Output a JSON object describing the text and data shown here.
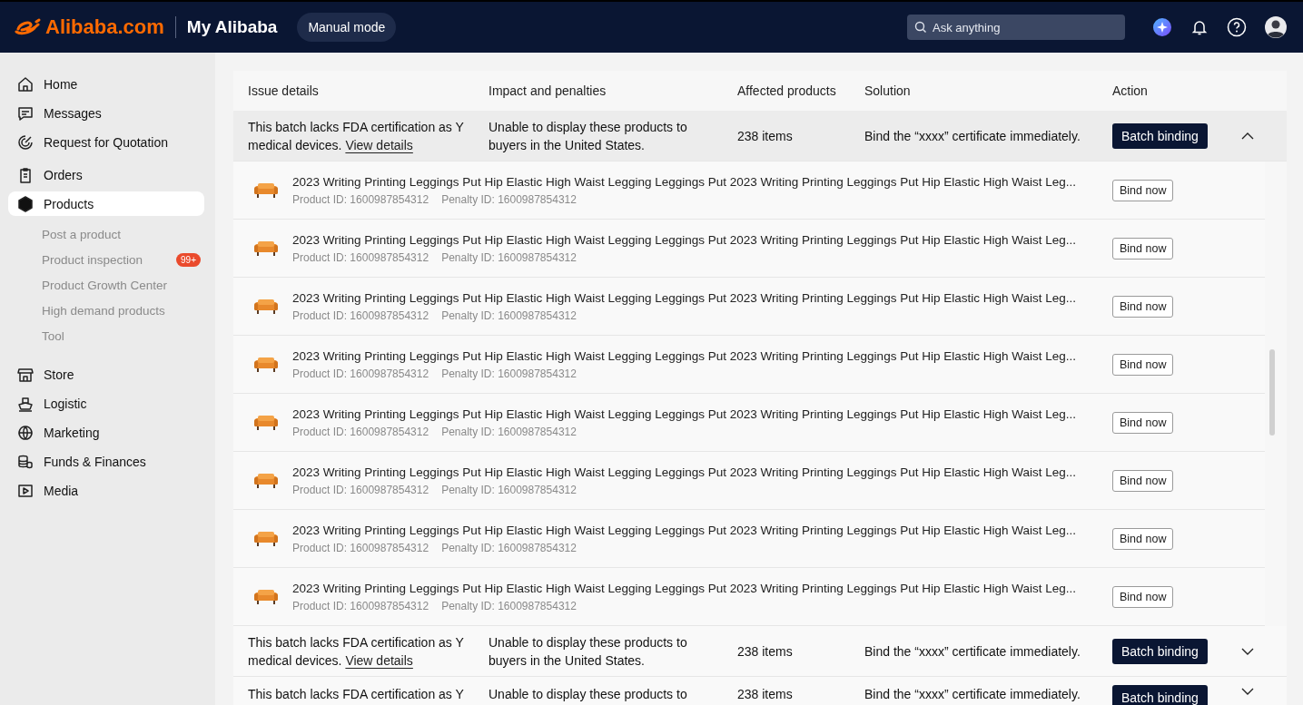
{
  "header": {
    "logo": "Alibaba.com",
    "title": "My Alibaba",
    "mode_button": "Manual mode",
    "search": {
      "placeholder": "Ask anything"
    }
  },
  "sidebar": {
    "items": [
      {
        "label": "Home",
        "selected": false
      },
      {
        "label": "Messages",
        "selected": false
      },
      {
        "label": "Request for Quotation",
        "selected": false
      },
      {
        "label": "Orders",
        "selected": false
      },
      {
        "label": "Products",
        "selected": true,
        "children": [
          {
            "label": "Post a product"
          },
          {
            "label": "Product inspection",
            "badge": "99+"
          },
          {
            "label": "Product Growth Center"
          },
          {
            "label": "High demand products"
          },
          {
            "label": "Tool"
          }
        ]
      },
      {
        "label": "Store",
        "selected": false
      },
      {
        "label": "Logistic",
        "selected": false
      },
      {
        "label": "Marketing",
        "selected": false
      },
      {
        "label": "Funds & Finances",
        "selected": false
      },
      {
        "label": "Media",
        "selected": false
      }
    ]
  },
  "table": {
    "columns": [
      "Issue details",
      "Impact and penalties",
      "Affected products",
      "Solution",
      "Action"
    ],
    "groups": [
      {
        "issue": "This batch lacks FDA certification as Y medical devices.",
        "link": "View details",
        "impact": "Unable to display these products to buyers in the United States.",
        "affected": "238 items",
        "solution": "Bind the “xxxx” certificate immediately.",
        "action": "Batch binding",
        "expanded": true,
        "products": [
          {
            "title": "2023 Writing Printing Leggings Put Hip Elastic High Waist Legging Leggings Put 2023 Writing Printing Leggings Put Hip Elastic High Waist Leg...",
            "product_id": "Product ID: 1600987854312",
            "penalty_id": "Penalty ID: 1600987854312",
            "action": "Bind now"
          },
          {
            "title": "2023 Writing Printing Leggings Put Hip Elastic High Waist Legging Leggings Put 2023 Writing Printing Leggings Put Hip Elastic High Waist Leg...",
            "product_id": "Product ID: 1600987854312",
            "penalty_id": "Penalty ID: 1600987854312",
            "action": "Bind now"
          },
          {
            "title": "2023 Writing Printing Leggings Put Hip Elastic High Waist Legging Leggings Put 2023 Writing Printing Leggings Put Hip Elastic High Waist Leg...",
            "product_id": "Product ID: 1600987854312",
            "penalty_id": "Penalty ID: 1600987854312",
            "action": "Bind now"
          },
          {
            "title": "2023 Writing Printing Leggings Put Hip Elastic High Waist Legging Leggings Put 2023 Writing Printing Leggings Put Hip Elastic High Waist Leg...",
            "product_id": "Product ID: 1600987854312",
            "penalty_id": "Penalty ID: 1600987854312",
            "action": "Bind now"
          },
          {
            "title": "2023 Writing Printing Leggings Put Hip Elastic High Waist Legging Leggings Put 2023 Writing Printing Leggings Put Hip Elastic High Waist Leg...",
            "product_id": "Product ID: 1600987854312",
            "penalty_id": "Penalty ID: 1600987854312",
            "action": "Bind now"
          },
          {
            "title": "2023 Writing Printing Leggings Put Hip Elastic High Waist Legging Leggings Put 2023 Writing Printing Leggings Put Hip Elastic High Waist Leg...",
            "product_id": "Product ID: 1600987854312",
            "penalty_id": "Penalty ID: 1600987854312",
            "action": "Bind now"
          },
          {
            "title": "2023 Writing Printing Leggings Put Hip Elastic High Waist Legging Leggings Put 2023 Writing Printing Leggings Put Hip Elastic High Waist Leg...",
            "product_id": "Product ID: 1600987854312",
            "penalty_id": "Penalty ID: 1600987854312",
            "action": "Bind now"
          },
          {
            "title": "2023 Writing Printing Leggings Put Hip Elastic High Waist Legging Leggings Put 2023 Writing Printing Leggings Put Hip Elastic High Waist Leg...",
            "product_id": "Product ID: 1600987854312",
            "penalty_id": "Penalty ID: 1600987854312",
            "action": "Bind now"
          }
        ]
      },
      {
        "issue": "This batch lacks FDA certification as Y medical devices.",
        "link": "View details",
        "impact": "Unable to display these products to buyers in the United States.",
        "affected": "238 items",
        "solution": "Bind the “xxxx” certificate immediately.",
        "action": "Batch binding",
        "expanded": false
      },
      {
        "issue": "This batch lacks FDA certification as Y",
        "impact": "Unable to display these products to",
        "affected": "238 items",
        "solution": "Bind the “xxxx” certificate immediately.",
        "action": "Batch binding",
        "expanded": false
      }
    ]
  }
}
